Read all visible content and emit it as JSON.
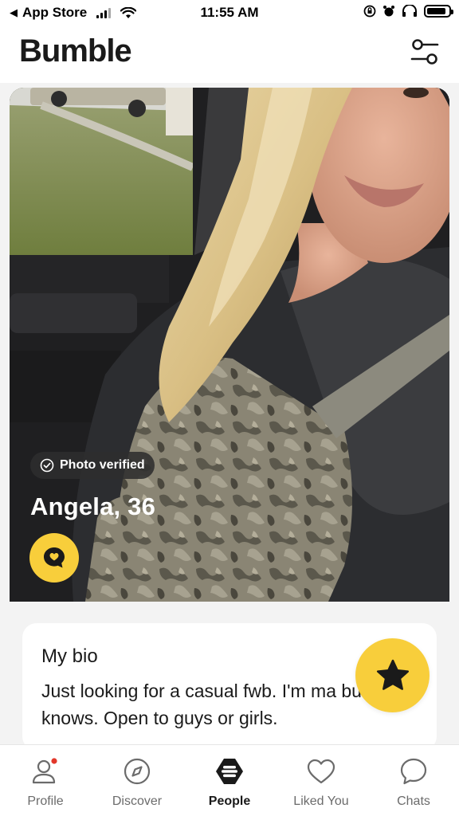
{
  "status_bar": {
    "back_app": "App Store",
    "time": "11:55 AM"
  },
  "header": {
    "brand": "Bumble",
    "filter_icon": "sliders-icon"
  },
  "profile": {
    "verified_label": "Photo verified",
    "name_age": "Angela, 36",
    "compliment_icon": "compliment-bubble-icon"
  },
  "bio": {
    "title": "My bio",
    "text": "Just looking for a casual fwb. I'm ma but he knows. Open to guys or girls."
  },
  "superswipe_icon": "star-icon",
  "nav": {
    "items": [
      {
        "label": "Profile",
        "icon": "person-icon",
        "badge": true
      },
      {
        "label": "Discover",
        "icon": "compass-icon"
      },
      {
        "label": "People",
        "icon": "bumble-hive-icon",
        "active": true
      },
      {
        "label": "Liked You",
        "icon": "heart-icon"
      },
      {
        "label": "Chats",
        "icon": "chat-bubble-icon"
      }
    ]
  },
  "colors": {
    "accent": "#f8ce3b",
    "badge": "#e2372a",
    "text": "#1a1a1a",
    "muted": "#6b6b6b"
  }
}
